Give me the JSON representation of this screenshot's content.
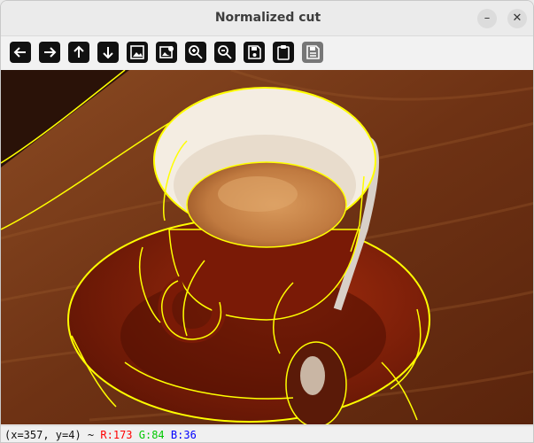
{
  "window": {
    "title": "Normalized cut"
  },
  "window_controls": {
    "minimize": "–",
    "close": "✕"
  },
  "toolbar": {
    "buttons": [
      {
        "icon": "arrow-left-icon",
        "enabled": true
      },
      {
        "icon": "arrow-right-icon",
        "enabled": true
      },
      {
        "icon": "arrow-up-icon",
        "enabled": true
      },
      {
        "icon": "arrow-down-icon",
        "enabled": true
      },
      {
        "icon": "image-icon",
        "enabled": true
      },
      {
        "icon": "image-settings-icon",
        "enabled": true
      },
      {
        "icon": "zoom-in-icon",
        "enabled": true
      },
      {
        "icon": "zoom-out-icon",
        "enabled": true
      },
      {
        "icon": "save-icon",
        "enabled": true
      },
      {
        "icon": "clipboard-icon",
        "enabled": true
      },
      {
        "icon": "properties-icon",
        "enabled": false
      }
    ]
  },
  "status": {
    "coords": "(x=357, y=4) ~",
    "r": "R:173",
    "g": "G:84",
    "b": "B:36",
    "colors": {
      "r": "#ff0000",
      "g": "#00c800",
      "b": "#0000ff"
    }
  },
  "image": {
    "description_colors": {
      "wood": "#7a3a1a",
      "saucer": "#7e1a08",
      "crema": "#c8824a",
      "segment_outline": "#ffff00"
    }
  }
}
